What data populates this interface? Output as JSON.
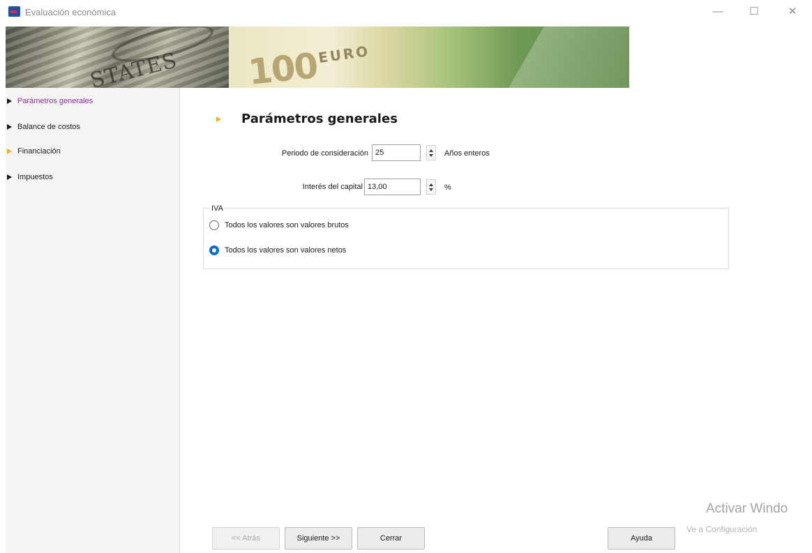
{
  "window": {
    "title": "Evaluación económica",
    "controls": {
      "minimize": "—",
      "maximize": "☐",
      "close": "✕"
    }
  },
  "banner": {
    "euro_value": "100",
    "euro_word": "EURO",
    "dollar_text": "STATES"
  },
  "sidebar": {
    "items": [
      {
        "label": "Parámetros generales",
        "icon": "triangle-right-icon",
        "active": true
      },
      {
        "label": "Balance de costos",
        "icon": "triangle-right-icon",
        "active": false
      },
      {
        "label": "Financiación",
        "icon": "triangle-right-icon",
        "active": false
      },
      {
        "label": "Impuestos",
        "icon": "triangle-right-icon",
        "active": false
      }
    ]
  },
  "main": {
    "section_title": "Parámetros generales",
    "periodo": {
      "label": "Periodo de consideración",
      "value": "25",
      "unit": "Años enteros"
    },
    "interes": {
      "label": "Interés del capital",
      "value": "13,00",
      "unit": "%"
    },
    "iva": {
      "legend": "IVA",
      "options": [
        {
          "label": "Todos los valores son valores brutos",
          "checked": false
        },
        {
          "label": "Todos los valores son valores netos",
          "checked": true
        }
      ]
    }
  },
  "buttons": {
    "back": "<< Atrás",
    "next": "Siguiente >>",
    "close": "Cerrar",
    "help": "Ayuda"
  },
  "watermark": {
    "line1": "Activar Windo",
    "line2": "Ve a Configuración"
  },
  "colors": {
    "accent_arrow": "#f2b01e",
    "active_nav_text": "#8a2b96",
    "radio_checked": "#0a6bd1"
  }
}
